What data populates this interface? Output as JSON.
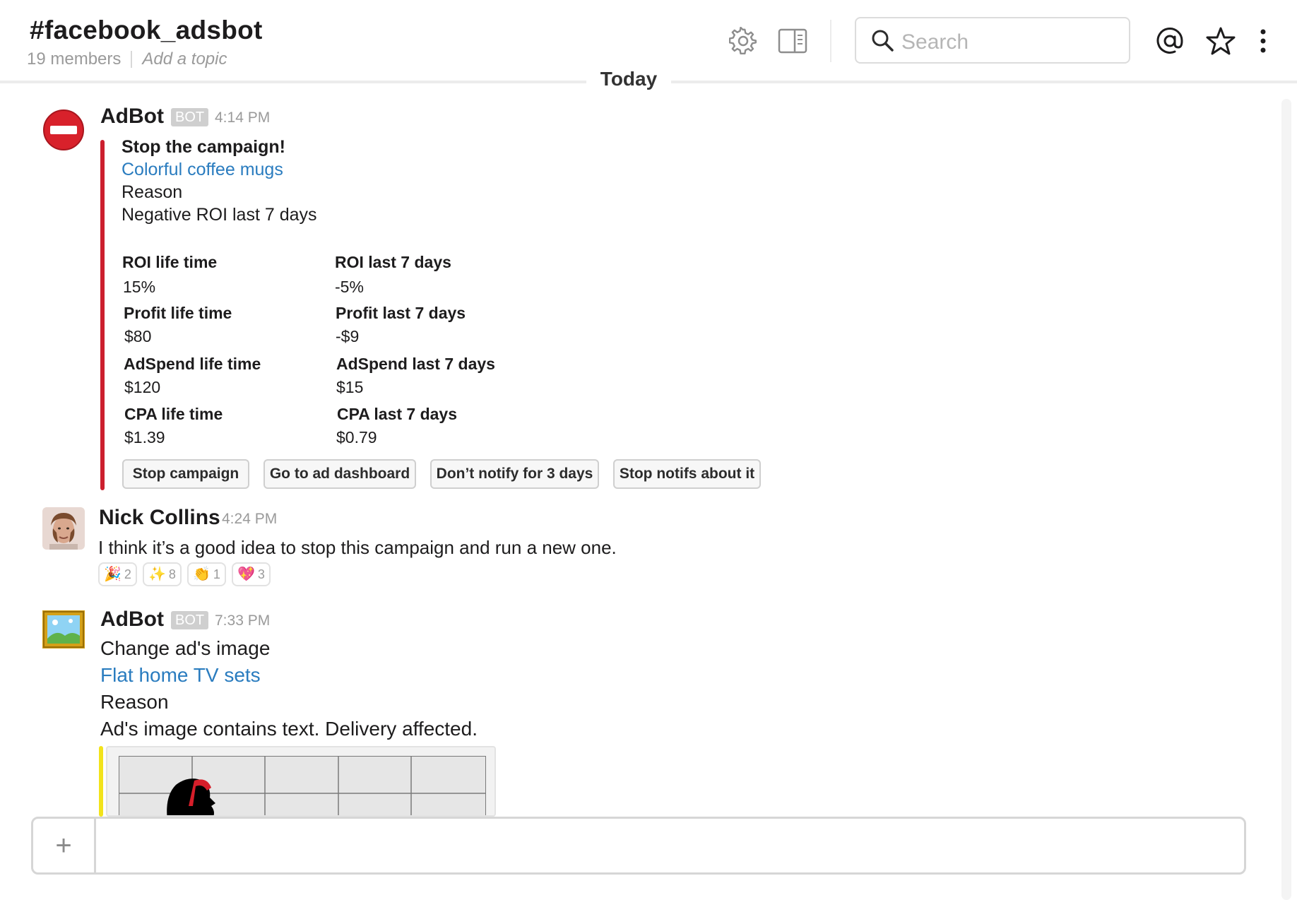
{
  "header": {
    "channel_name": "#facebook_adsbot",
    "members": "19 members",
    "topic_placeholder": "Add a topic",
    "search_placeholder": "Search"
  },
  "day_divider": "Today",
  "messages": [
    {
      "sender": "AdBot",
      "badge": "BOT",
      "time": "4:14 PM",
      "avatar_icon": "no-entry-icon",
      "attachment": {
        "color": "#cc1f2e",
        "title": "Stop the campaign!",
        "link": "Colorful coffee mugs",
        "reason_label": "Reason",
        "reason_text": "Negative ROI last 7 days",
        "fields": [
          {
            "label": "ROI life time",
            "value": "15%"
          },
          {
            "label": "ROI last 7 days",
            "value": "-5%"
          },
          {
            "label": "Profit life time",
            "value": "$80"
          },
          {
            "label": "Profit last 7 days",
            "value": "-$9"
          },
          {
            "label": "AdSpend life time",
            "value": "$120"
          },
          {
            "label": "AdSpend last 7 days",
            "value": "$15"
          },
          {
            "label": "CPA life time",
            "value": "$1.39"
          },
          {
            "label": "CPA last 7 days",
            "value": "$0.79"
          }
        ],
        "actions": [
          "Stop campaign",
          "Go to ad dashboard",
          "Don’t notify for 3 days",
          "Stop notifs about it"
        ]
      }
    },
    {
      "sender": "Nick Collins",
      "time": "4:24 PM",
      "text": "I think it’s a good idea to stop this campaign and run a new one.",
      "reactions": [
        {
          "emoji": "🎉",
          "count": "2"
        },
        {
          "emoji": "✨",
          "count": "8"
        },
        {
          "emoji": "👏",
          "count": "1"
        },
        {
          "emoji": "💖",
          "count": "3"
        }
      ]
    },
    {
      "sender": "AdBot",
      "badge": "BOT",
      "time": "7:33 PM",
      "avatar_icon": "framed-picture-icon",
      "title": "Change ad's image",
      "link": "Flat home TV sets",
      "reason_label": "Reason",
      "reason_text": "Ad's image contains text. Delivery affected.",
      "attachment_color": "#f2e31b"
    }
  ]
}
